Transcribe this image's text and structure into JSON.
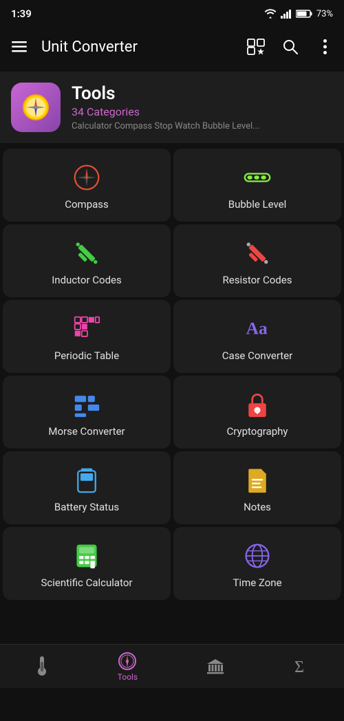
{
  "statusBar": {
    "time": "1:39",
    "batteryPercent": "73%"
  },
  "appBar": {
    "menuIcon": "☰",
    "title": "Unit Converter",
    "gridStarIcon": "⊞★",
    "searchIcon": "🔍",
    "moreIcon": "⋮"
  },
  "header": {
    "title": "Tools",
    "subtitle": "34 Categories",
    "description": "Calculator Compass Stop Watch Bubble Level..."
  },
  "gridItems": [
    {
      "id": "compass",
      "label": "Compass",
      "iconColor": "#e05030",
      "iconType": "compass"
    },
    {
      "id": "bubble-level",
      "label": "Bubble Level",
      "iconColor": "#88ee44",
      "iconType": "bubble"
    },
    {
      "id": "inductor-codes",
      "label": "Inductor Codes",
      "iconColor": "#44cc44",
      "iconType": "inductor"
    },
    {
      "id": "resistor-codes",
      "label": "Resistor Codes",
      "iconColor": "#ee4444",
      "iconType": "resistor"
    },
    {
      "id": "periodic-table",
      "label": "Periodic Table",
      "iconColor": "#ee44aa",
      "iconType": "periodic"
    },
    {
      "id": "case-converter",
      "label": "Case Converter",
      "iconColor": "#8866ee",
      "iconType": "case"
    },
    {
      "id": "morse-converter",
      "label": "Morse Converter",
      "iconColor": "#4488ee",
      "iconType": "morse"
    },
    {
      "id": "cryptography",
      "label": "Cryptography",
      "iconColor": "#ee4444",
      "iconType": "lock"
    },
    {
      "id": "battery-status",
      "label": "Battery Status",
      "iconColor": "#44aaee",
      "iconType": "battery"
    },
    {
      "id": "notes",
      "label": "Notes",
      "iconColor": "#ddaa22",
      "iconType": "notes"
    },
    {
      "id": "scientific-calculator",
      "label": "Scientific Calculator",
      "iconColor": "#44cc44",
      "iconType": "calc"
    },
    {
      "id": "time-zone",
      "label": "Time Zone",
      "iconColor": "#8866ee",
      "iconType": "globe"
    }
  ],
  "bottomNav": [
    {
      "id": "thermometer",
      "label": "",
      "iconType": "thermometer",
      "active": false
    },
    {
      "id": "tools",
      "label": "Tools",
      "iconType": "compass-nav",
      "active": true
    },
    {
      "id": "bank",
      "label": "",
      "iconType": "bank",
      "active": false
    },
    {
      "id": "sigma",
      "label": "",
      "iconType": "sigma",
      "active": false
    }
  ]
}
